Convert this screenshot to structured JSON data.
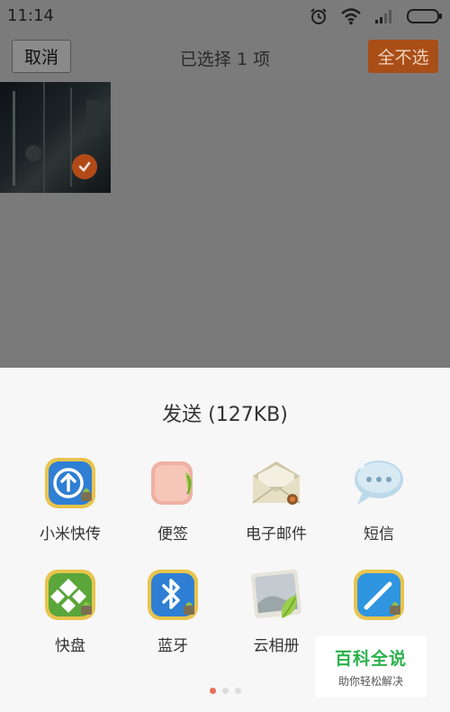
{
  "status_bar": {
    "time": "11:14"
  },
  "action_bar": {
    "cancel_label": "取消",
    "title": "已选择 1 项",
    "deselect_all_label": "全不选"
  },
  "sheet": {
    "title": "发送 (127KB)",
    "items": [
      {
        "label": "小米快传",
        "icon": "mi-drop-icon"
      },
      {
        "label": "便签",
        "icon": "notes-icon"
      },
      {
        "label": "电子邮件",
        "icon": "email-icon"
      },
      {
        "label": "短信",
        "icon": "sms-icon"
      },
      {
        "label": "快盘",
        "icon": "kuaipan-icon"
      },
      {
        "label": "蓝牙",
        "icon": "bluetooth-icon"
      },
      {
        "label": "云相册",
        "icon": "cloud-album-icon"
      },
      {
        "label": "",
        "icon": "edit-icon"
      }
    ],
    "page_indicator": {
      "pages": 3,
      "current": 1
    }
  },
  "watermark": {
    "title": "百科全说",
    "subtitle": "助你轻松解决"
  },
  "colors": {
    "accent": "#a94e17",
    "check": "#b24a18",
    "dot_active": "#e9705a",
    "watermark_green": "#2bb24c"
  }
}
